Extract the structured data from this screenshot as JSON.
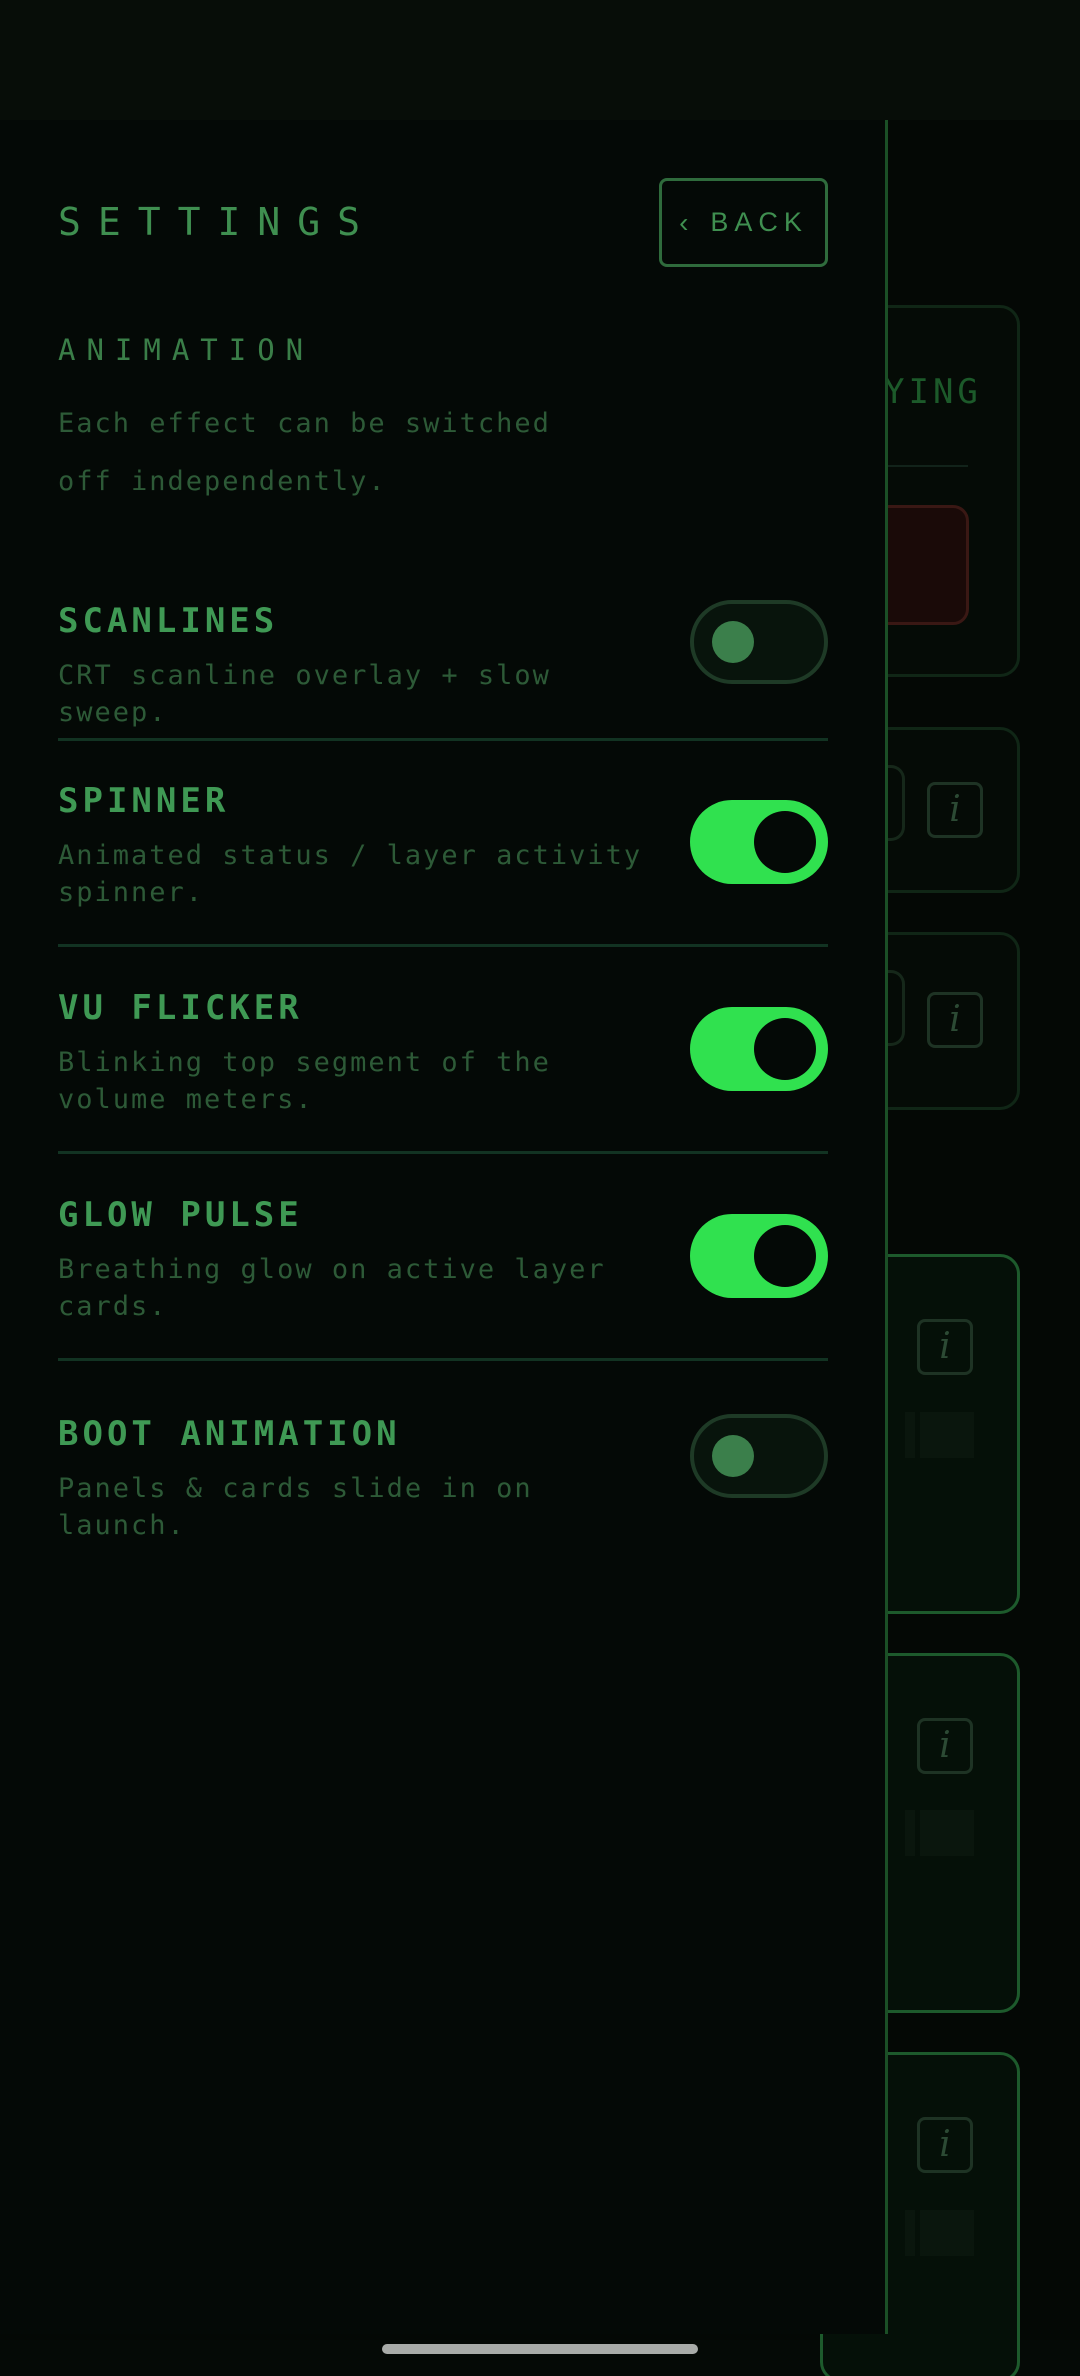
{
  "header": {
    "title": "SETTINGS",
    "back_label": "BACK"
  },
  "section": {
    "heading": "ANIMATION",
    "description": "Each effect can be switched off independently."
  },
  "settings": [
    {
      "name": "SCANLINES",
      "description": "CRT scanline overlay + slow sweep.",
      "enabled": false
    },
    {
      "name": "SPINNER",
      "description": "Animated status / layer activity spinner.",
      "enabled": true
    },
    {
      "name": "VU FLICKER",
      "description": "Blinking top segment of the volume meters.",
      "enabled": true
    },
    {
      "name": "GLOW PULSE",
      "description": "Breathing glow on active layer cards.",
      "enabled": true
    },
    {
      "name": "BOOT ANIMATION",
      "description": "Panels & cards slide in on launch.",
      "enabled": false
    }
  ],
  "background": {
    "status_text_fragment": "YING",
    "info_icon_glyph": "i"
  },
  "icons": {
    "back": "chevron-left-icon",
    "info": "info-icon"
  },
  "colors": {
    "accent": "#30e14f",
    "text_primary": "#3f9954",
    "text_secondary": "#2d5a37",
    "background": "#040906",
    "border": "#1b4f26"
  }
}
